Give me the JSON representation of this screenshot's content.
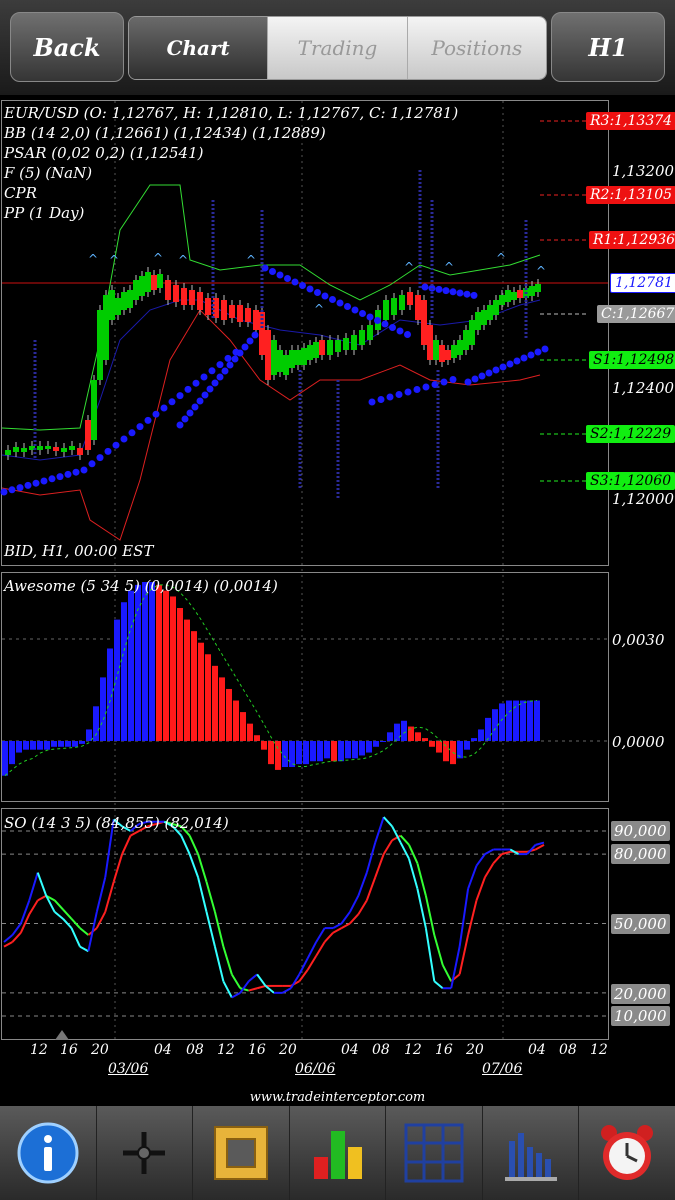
{
  "topbar": {
    "back_label": "Back",
    "tabs": [
      {
        "label": "Chart",
        "active": true
      },
      {
        "label": "Trading",
        "active": false
      },
      {
        "label": "Positions",
        "active": false
      }
    ],
    "timeframe_label": "H1"
  },
  "main_chart": {
    "ohlc": "EUR/USD (O: 1,12767, H: 1,12810, L: 1,12767, C: 1,12781)",
    "bb": "BB (14 2,0) (1,12661) (1,12434) (1,12889)",
    "psar": "PSAR (0,02 0,2) (1,12541)",
    "fractal": "F (5) (NaN)",
    "cpr": "CPR",
    "pp": "PP (1 Day)",
    "footer_label": "BID, H1, 00:00 EST",
    "levels": {
      "r3": "R3:1,13374",
      "r2": "R2:1,13105",
      "r1": "R1:1,12936",
      "current": "1,12781",
      "c": "C:1,12667",
      "s1": "S1:1,12498",
      "s2": "S2:1,12229",
      "s3": "S3:1,12060"
    },
    "price_ticks": [
      "1,13200",
      "1,12400",
      "1,12000"
    ],
    "colors": {
      "up": "#00cc00",
      "down": "#ff2020",
      "psar": "#1a1aff",
      "bb_upper": "#33dd33",
      "bb_mid": "#1a1aaa",
      "bb_lower": "#dd2020"
    }
  },
  "awesome": {
    "label": "Awesome (5 34 5) (0,0014) (0,0014)",
    "ticks": [
      "0,0030",
      "0,0000"
    ],
    "values": [
      -0.0012,
      -0.0008,
      -0.0004,
      -0.0003,
      -0.0003,
      -0.0003,
      -0.0003,
      -0.0002,
      -0.0002,
      -0.0002,
      -0.0002,
      -0.0001,
      0.0004,
      0.0012,
      0.0022,
      0.0032,
      0.0042,
      0.0048,
      0.0052,
      0.0054,
      0.0055,
      0.0055,
      0.0054,
      0.0052,
      0.005,
      0.0046,
      0.0042,
      0.0038,
      0.0034,
      0.003,
      0.0026,
      0.0022,
      0.0018,
      0.0014,
      0.001,
      0.0006,
      0.0002,
      -0.0003,
      -0.0008,
      -0.001,
      -0.0009,
      -0.0009,
      -0.0008,
      -0.0008,
      -0.0007,
      -0.0007,
      -0.0006,
      -0.0007,
      -0.0007,
      -0.0006,
      -0.0006,
      -0.0005,
      -0.0004,
      -0.0002,
      0.0,
      0.0003,
      0.0006,
      0.0007,
      0.0005,
      0.0003,
      0.0001,
      -0.0002,
      -0.0004,
      -0.0007,
      -0.0008,
      -0.0006,
      -0.0003,
      0.0001,
      0.0004,
      0.0008,
      0.0011,
      0.0013,
      0.0014,
      0.0014,
      0.0014,
      0.0014,
      0.0014
    ],
    "colors": {
      "up": "#1a1aff",
      "down": "#ff1a1a",
      "signal": "#22cc22"
    }
  },
  "stochastic": {
    "label": "SO (14 3 5) (84,855) (82,014)",
    "levels": [
      "90,000",
      "80,000",
      "50,000",
      "20,000",
      "10,000"
    ],
    "k": [
      42,
      45,
      50,
      60,
      72,
      62,
      55,
      52,
      48,
      40,
      38,
      55,
      70,
      95,
      92,
      90,
      93,
      94,
      94,
      94,
      92,
      88,
      80,
      70,
      55,
      40,
      25,
      18,
      20,
      25,
      28,
      23,
      20,
      20,
      22,
      28,
      35,
      42,
      48,
      48,
      50,
      55,
      62,
      72,
      85,
      96,
      92,
      85,
      78,
      65,
      48,
      25,
      22,
      22,
      40,
      65,
      75,
      80,
      82,
      82,
      82,
      80,
      80,
      84,
      85
    ],
    "d": [
      40,
      42,
      46,
      54,
      60,
      62,
      60,
      56,
      52,
      48,
      45,
      48,
      55,
      68,
      80,
      88,
      90,
      92,
      93,
      94,
      93,
      92,
      88,
      80,
      68,
      55,
      40,
      28,
      22,
      21,
      22,
      23,
      23,
      23,
      23,
      25,
      30,
      36,
      42,
      46,
      48,
      50,
      54,
      60,
      70,
      80,
      86,
      88,
      84,
      76,
      62,
      45,
      32,
      25,
      28,
      45,
      60,
      70,
      76,
      80,
      81,
      81,
      81,
      82,
      84
    ],
    "colors": {
      "k_rising": "#1a1aff",
      "k_falling": "#33ffff",
      "d_rising": "#ff2020",
      "d_falling": "#33ff33"
    }
  },
  "x_axis": {
    "ticks": [
      "12",
      "16",
      "20",
      "04",
      "08",
      "12",
      "16",
      "20",
      "04",
      "08",
      "12",
      "16",
      "20",
      "04",
      "08",
      "12"
    ],
    "dates": [
      "03/06",
      "06/06",
      "07/06"
    ]
  },
  "footer": {
    "url": "www.tradeinterceptor.com"
  },
  "toolbar": {
    "items": [
      "info-icon",
      "crosshair-icon",
      "drawing-tools-icon",
      "indicators-icon",
      "grid-icon",
      "volume-icon",
      "alarm-icon"
    ]
  }
}
